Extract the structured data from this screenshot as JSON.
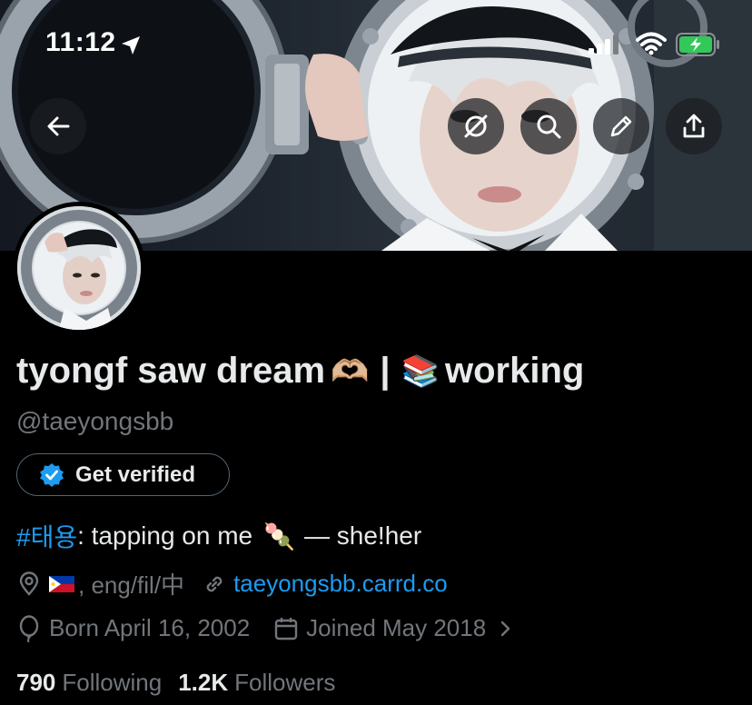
{
  "status_bar": {
    "time": "11:12"
  },
  "header": {
    "icons": [
      "back-arrow-icon",
      "grok-icon",
      "search-icon",
      "edit-icon",
      "share-icon"
    ]
  },
  "profile": {
    "display_name_part1": "tyongf saw dream",
    "display_name_emoji1": "🫶🏼",
    "display_name_sep": "|",
    "display_name_emoji2": "📚",
    "display_name_part2": "working",
    "username": "@taeyongsbb",
    "verify_button": "Get verified",
    "bio_hashtag": "#태용",
    "bio_text": ": tapping on me",
    "bio_emoji": "🍡",
    "bio_suffix": "— she!her",
    "location_text": ", eng/fil/中",
    "link": "taeyongsbb.carrd.co",
    "birthday": "Born April 16, 2002",
    "joined": "Joined May 2018"
  },
  "stats": {
    "following_count": "790",
    "following_label": "Following",
    "followers_count": "1.2K",
    "followers_label": "Followers"
  },
  "colors": {
    "background": "#000000",
    "text": "#e7e9ea",
    "muted": "#71767b",
    "link": "#1d9bf0",
    "battery": "#34c759"
  }
}
